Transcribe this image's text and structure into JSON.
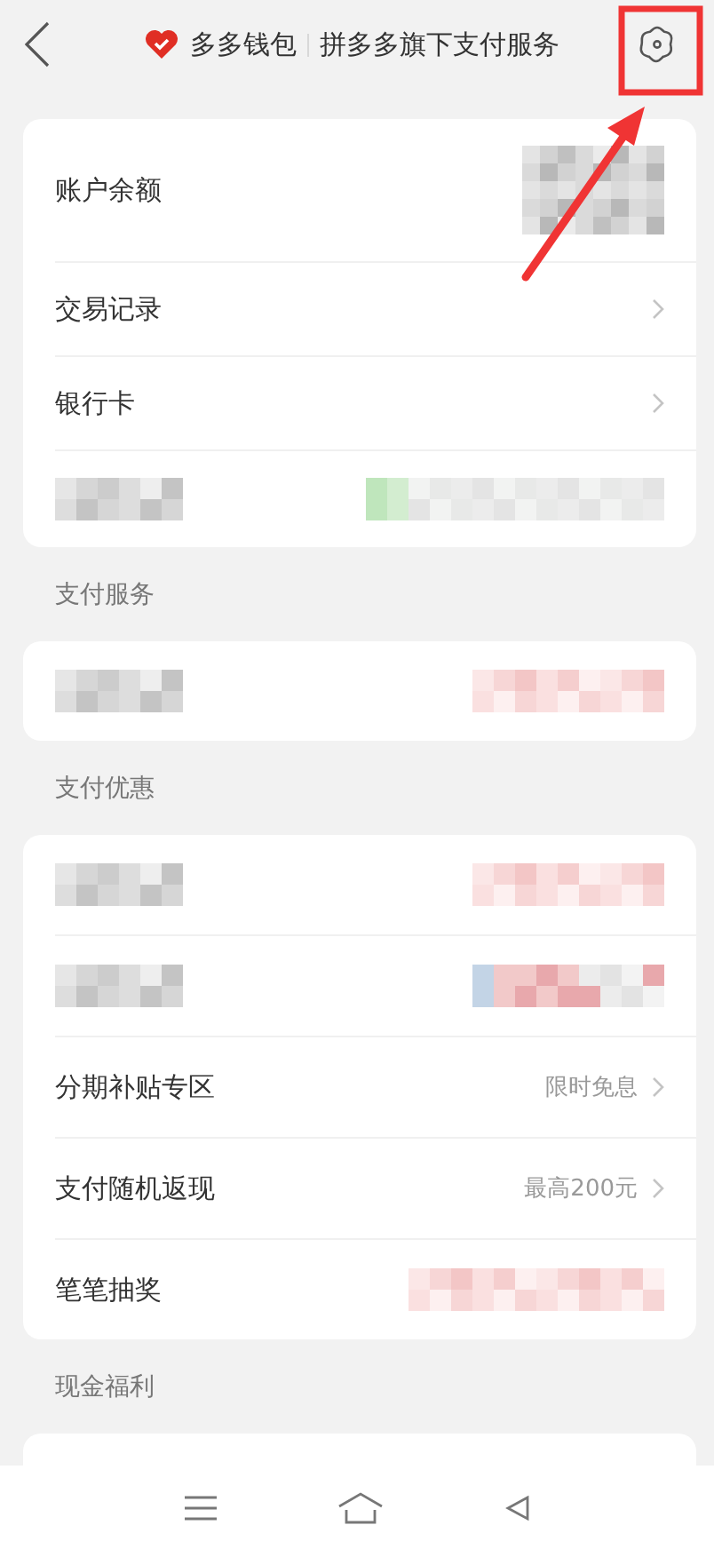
{
  "header": {
    "brand": "多多钱包",
    "subtitle": "拼多多旗下支付服务"
  },
  "sections": [
    {
      "rows": [
        {
          "kind": "balance",
          "label": "账户余额"
        },
        {
          "kind": "link",
          "label": "交易记录"
        },
        {
          "kind": "link",
          "label": "银行卡"
        },
        {
          "kind": "blurred"
        }
      ]
    },
    {
      "title": "支付服务",
      "rows": [
        {
          "kind": "blurred"
        }
      ]
    },
    {
      "title": "支付优惠",
      "rows": [
        {
          "kind": "blurred"
        },
        {
          "kind": "blurred"
        },
        {
          "kind": "link",
          "label": "分期补贴专区",
          "value": "限时免息"
        },
        {
          "kind": "link",
          "label": "支付随机返现",
          "value": "最高200元"
        },
        {
          "kind": "prize",
          "label": "笔笔抽奖"
        }
      ]
    },
    {
      "title": "现金福利"
    }
  ]
}
